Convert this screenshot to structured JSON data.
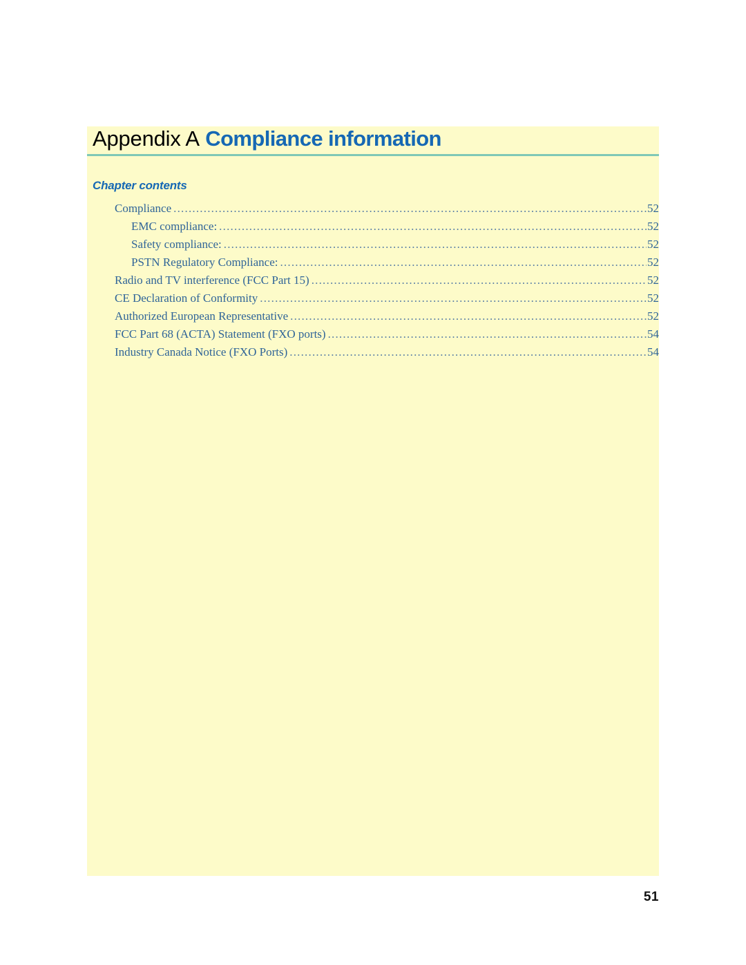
{
  "document": {
    "title_prefix": "Appendix A",
    "title_name": "Compliance information",
    "page_number": "51"
  },
  "chapter_contents": {
    "heading": "Chapter contents",
    "leader_dots": "....................................................................................................................................................................................................................................................",
    "entries": [
      {
        "label": "Compliance",
        "page": "52",
        "level": 1
      },
      {
        "label": "EMC compliance:",
        "page": "52",
        "level": 2
      },
      {
        "label": "Safety compliance:",
        "page": "52",
        "level": 2
      },
      {
        "label": "PSTN Regulatory Compliance:",
        "page": "52",
        "level": 2
      },
      {
        "label": "Radio and TV interference (FCC Part 15)",
        "page": "52",
        "level": 1
      },
      {
        "label": "CE Declaration of Conformity",
        "page": "52",
        "level": 1
      },
      {
        "label": "Authorized European Representative",
        "page": "52",
        "level": 1
      },
      {
        "label": "FCC Part 68 (ACTA) Statement (FXO ports)",
        "page": "54",
        "level": 1
      },
      {
        "label": "Industry Canada Notice (FXO Ports)",
        "page": "54",
        "level": 1
      }
    ]
  },
  "colors": {
    "panel_background": "#fdfbc9",
    "title_accent": "#1668b4",
    "rule": "#7fc8b6",
    "toc_text": "#2f6498",
    "page_background": "#ffffff"
  }
}
